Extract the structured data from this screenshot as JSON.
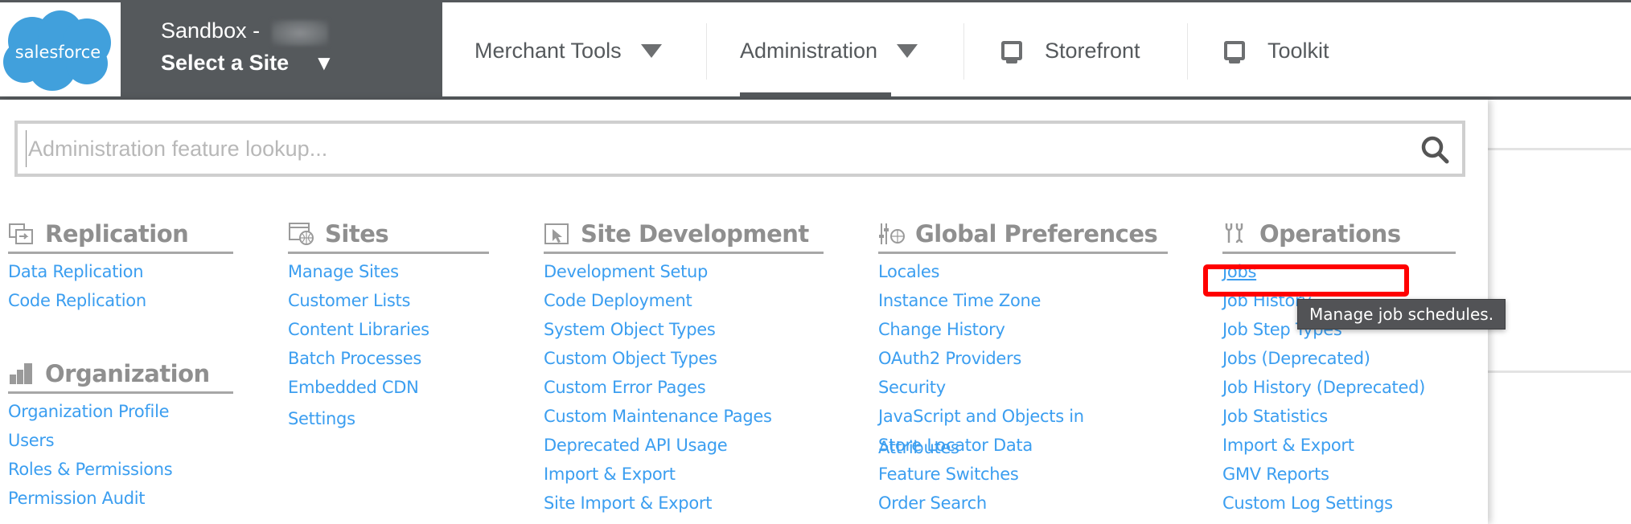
{
  "header": {
    "logo_text": "salesforce",
    "site_selector": {
      "line1": "Sandbox -",
      "line2": "Select a Site",
      "caret": "▼"
    },
    "nav": [
      {
        "label": "Merchant Tools",
        "icon": "chevron-down-icon",
        "active": false
      },
      {
        "label": "Administration",
        "icon": "chevron-down-icon",
        "active": true
      },
      {
        "label": "Storefront",
        "icon": "monitor-icon",
        "active": false
      },
      {
        "label": "Toolkit",
        "icon": "monitor-icon",
        "active": false
      }
    ]
  },
  "search": {
    "placeholder": "Administration feature lookup...",
    "value": "",
    "icon": "search-icon"
  },
  "sections": [
    {
      "title": "Replication",
      "icon": "replication-icon",
      "links": [
        "Data Replication",
        "Code Replication"
      ]
    },
    {
      "title": "Organization",
      "icon": "organization-icon",
      "links": [
        "Organization Profile",
        "Users",
        "Roles & Permissions",
        "Permission Audit"
      ]
    },
    {
      "title": "Sites",
      "icon": "sites-icon",
      "links": [
        "Manage Sites",
        "Customer Lists",
        "Content Libraries",
        "Batch Processes",
        "Embedded CDN Settings"
      ]
    },
    {
      "title": "Site Development",
      "icon": "site-development-icon",
      "links": [
        "Development Setup",
        "Code Deployment",
        "System Object Types",
        "Custom Object Types",
        "Custom Error Pages",
        "Custom Maintenance Pages",
        "Deprecated API Usage",
        "Import & Export",
        "Site Import & Export"
      ]
    },
    {
      "title": "Global Preferences",
      "icon": "global-preferences-icon",
      "links": [
        "Locales",
        "Instance Time Zone",
        "Change History",
        "OAuth2 Providers",
        "Security",
        "JavaScript and Objects in Attributes",
        "Store Locator Data",
        "Feature Switches",
        "Order Search"
      ]
    },
    {
      "title": "Operations",
      "icon": "operations-icon",
      "links": [
        "Jobs",
        "Job History",
        "Job Step Types",
        "Jobs (Deprecated)",
        "Job History (Deprecated)",
        "Job Statistics",
        "Import & Export",
        "GMV Reports",
        "Custom Log Settings"
      ]
    }
  ],
  "tooltip": {
    "text": "Manage job schedules.",
    "target": "Jobs"
  },
  "colors": {
    "header_dark": "#55595c",
    "link_blue": "#3b9ef0",
    "section_gray": "#8f8f8f",
    "logo_blue": "#41a0dc",
    "highlight_red": "#ff0000",
    "tooltip_bg": "#525356"
  }
}
